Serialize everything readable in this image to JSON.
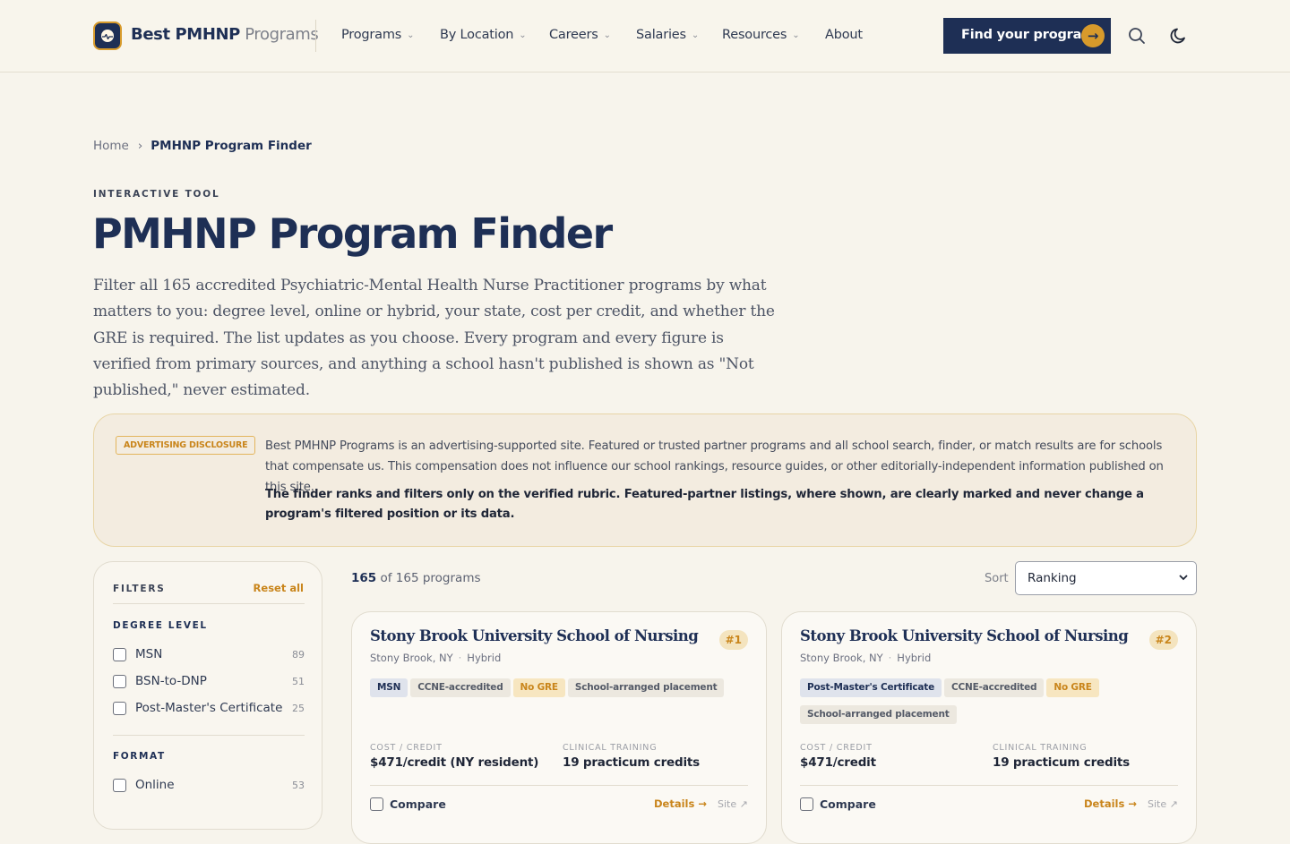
{
  "header": {
    "brand_bold": "Best PMHNP",
    "brand_light": "Programs",
    "nav": [
      {
        "label": "Programs",
        "has_dropdown": true
      },
      {
        "label": "By Location",
        "has_dropdown": true
      },
      {
        "label": "Careers",
        "has_dropdown": true
      },
      {
        "label": "Salaries",
        "has_dropdown": true
      },
      {
        "label": "Resources",
        "has_dropdown": true
      },
      {
        "label": "About",
        "has_dropdown": false
      }
    ],
    "cta_label": "Find your program",
    "cta_icon": "arrow-right-icon",
    "icons": [
      "search-icon",
      "moon-icon"
    ]
  },
  "breadcrumb": {
    "home": "Home",
    "current": "PMHNP Program Finder"
  },
  "hero": {
    "eyebrow": "INTERACTIVE TOOL",
    "title": "PMHNP Program Finder",
    "lead": "Filter all 165 accredited Psychiatric-Mental Health Nurse Practitioner programs by what matters to you: degree level, online or hybrid, your state, cost per credit, and whether the GRE is required. The list updates as you choose. Every program and every figure is verified from primary sources, and anything a school hasn't published is shown as \"Not published,\" never estimated."
  },
  "disclosure": {
    "tag": "ADVERTISING DISCLOSURE",
    "text": "Best PMHNP Programs is an advertising-supported site. Featured or trusted partner programs and all school search, finder, or match results are for schools that compensate us. This compensation does not influence our school rankings, resource guides, or other editorially-independent information published on this site.",
    "emphasis": "The finder ranks and filters only on the verified rubric. Featured-partner listings, where shown, are clearly marked and never change a program's filtered position or its data."
  },
  "filters": {
    "title": "FILTERS",
    "reset_label": "Reset all",
    "groups": [
      {
        "title": "DEGREE LEVEL",
        "options": [
          {
            "label": "MSN",
            "count": "89"
          },
          {
            "label": "BSN-to-DNP",
            "count": "51"
          },
          {
            "label": "Post-Master's Certificate",
            "count": "25"
          }
        ]
      },
      {
        "title": "FORMAT",
        "options": [
          {
            "label": "Online",
            "count": "53"
          }
        ]
      }
    ]
  },
  "results": {
    "shown": "165",
    "total_text": "of 165 programs",
    "sort_label": "Sort",
    "sort_value": "Ranking"
  },
  "programs": [
    {
      "name": "Stony Brook University School of Nursing",
      "rank": "#1",
      "city": "Stony Brook, NY",
      "format": "Hybrid",
      "tags": [
        {
          "label": "MSN",
          "style": "navy"
        },
        {
          "label": "CCNE-accredited",
          "style": "plain"
        },
        {
          "label": "No GRE",
          "style": "gold"
        },
        {
          "label": "School-arranged placement",
          "style": "plain"
        }
      ],
      "cost_label": "COST / CREDIT",
      "cost": "$471/credit (NY resident)",
      "clinical_label": "CLINICAL TRAINING",
      "clinical": "19 practicum credits",
      "compare_label": "Compare",
      "details_label": "Details →",
      "site_label": "Site ↗"
    },
    {
      "name": "Stony Brook University School of Nursing",
      "rank": "#2",
      "city": "Stony Brook, NY",
      "format": "Hybrid",
      "tags": [
        {
          "label": "Post-Master's Certificate",
          "style": "navy"
        },
        {
          "label": "CCNE-accredited",
          "style": "plain"
        },
        {
          "label": "No GRE",
          "style": "gold"
        },
        {
          "label": "School-arranged placement",
          "style": "plain"
        }
      ],
      "cost_label": "COST / CREDIT",
      "cost": "$471/credit",
      "clinical_label": "CLINICAL TRAINING",
      "clinical": "19 practicum credits",
      "compare_label": "Compare",
      "details_label": "Details →",
      "site_label": "Site ↗"
    }
  ],
  "colors": {
    "navy": "#1e2f55",
    "gold": "#d79a2b",
    "background": "#f7f4ec"
  }
}
